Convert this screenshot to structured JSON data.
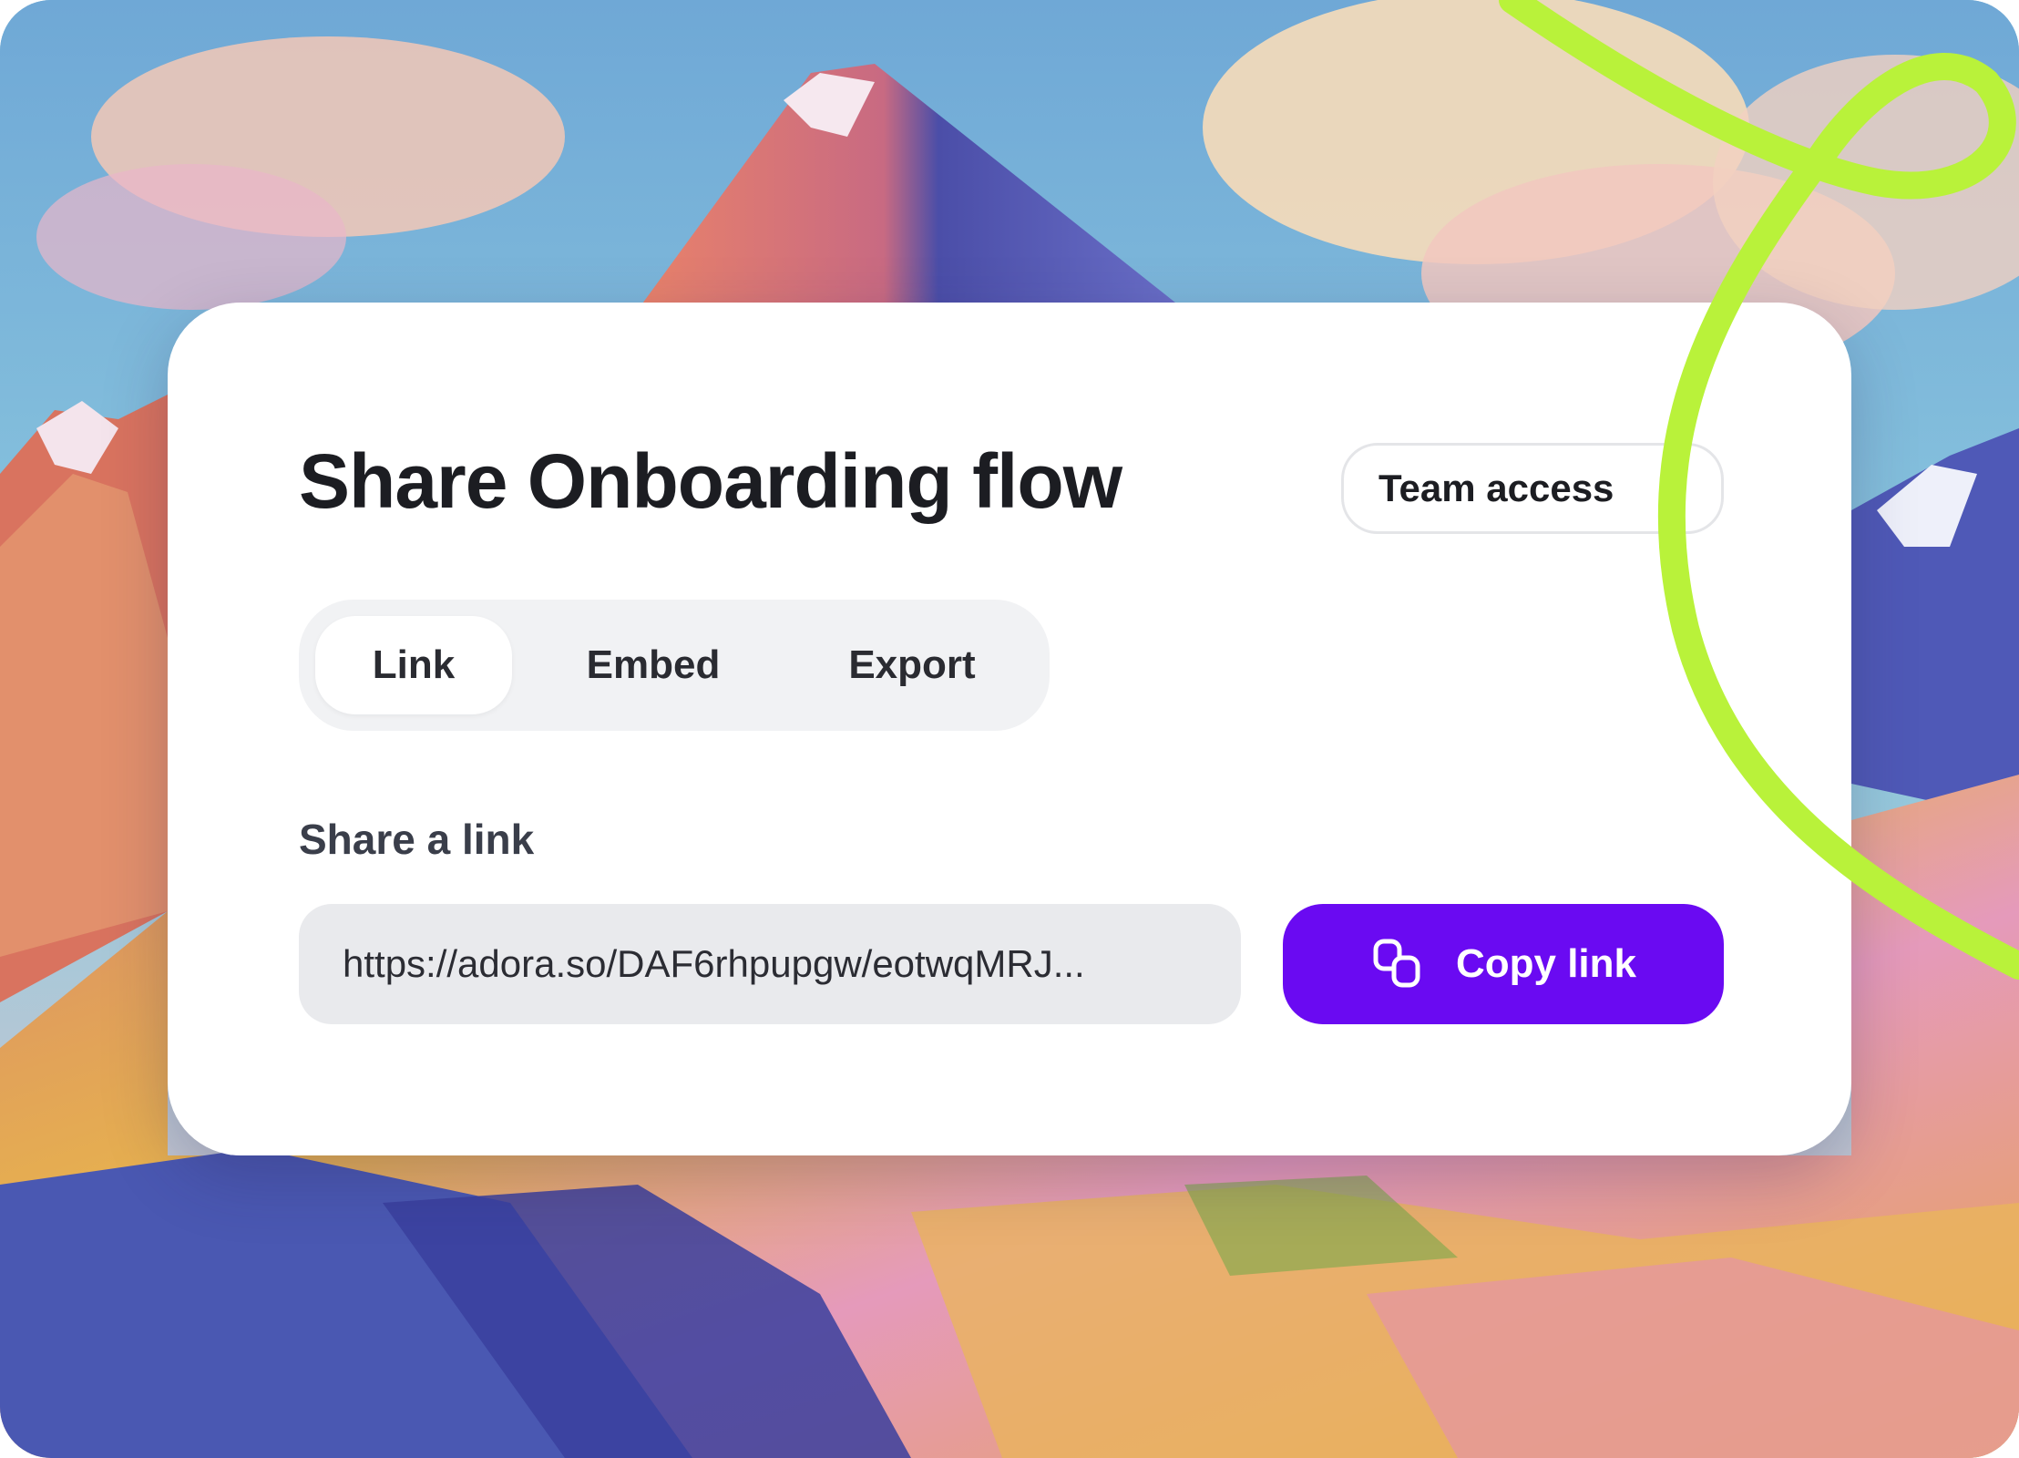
{
  "dialog": {
    "title": "Share Onboarding flow",
    "team_access_label": "Team access"
  },
  "tabs": [
    {
      "label": "Link",
      "active": true
    },
    {
      "label": "Embed",
      "active": false
    },
    {
      "label": "Export",
      "active": false
    }
  ],
  "share_link": {
    "section_label": "Share a link",
    "url_value": "https://adora.so/DAF6rhpupgw/eotwqMRJ...",
    "copy_label": "Copy link",
    "copy_icon": "copy-icon"
  },
  "colors": {
    "accent": "#6a0af2",
    "ribbon": "#b9f23a",
    "card": "#ffffff",
    "input_bg": "#e9eaed",
    "tabs_bg": "#f1f2f4"
  }
}
